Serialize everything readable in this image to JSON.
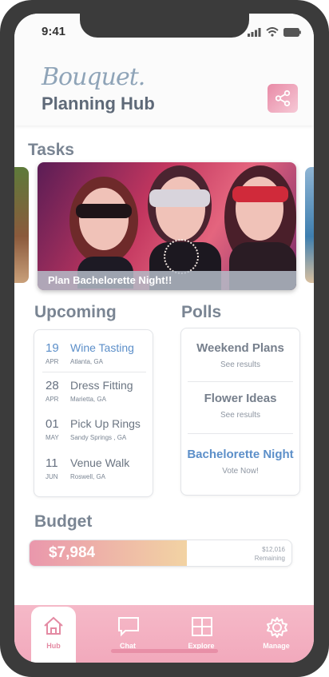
{
  "status": {
    "time": "9:41"
  },
  "header": {
    "logo": "Bouquet.",
    "title": "Planning Hub",
    "share_icon": "share-icon"
  },
  "tasks": {
    "heading": "Tasks",
    "card_label": "Plan Bachelorette Night!!"
  },
  "upcoming": {
    "heading": "Upcoming",
    "items": [
      {
        "day": "19",
        "month": "APR",
        "title": "Wine Tasting",
        "location": "Atlanta, GA",
        "highlight": true
      },
      {
        "day": "28",
        "month": "APR",
        "title": "Dress Fitting",
        "location": "Marietta, GA",
        "highlight": false
      },
      {
        "day": "01",
        "month": "MAY",
        "title": "Pick Up Rings",
        "location": "Sandy Springs , GA",
        "highlight": false
      },
      {
        "day": "11",
        "month": "JUN",
        "title": "Venue Walk",
        "location": "Roswell, GA",
        "highlight": false
      }
    ]
  },
  "polls": {
    "heading": "Polls",
    "items": [
      {
        "title": "Weekend Plans",
        "sub": "See results"
      },
      {
        "title": "Flower Ideas",
        "sub": "See results"
      },
      {
        "title": "Bachelorette Night",
        "sub": "Vote Now!"
      }
    ]
  },
  "budget": {
    "heading": "Budget",
    "spent": "$7,984",
    "remaining_amount": "$12,016",
    "remaining_label": "Remaining",
    "spent_fraction": 0.6
  },
  "tabs": [
    {
      "label": "Hub",
      "icon": "home-icon",
      "active": true
    },
    {
      "label": "Chat",
      "icon": "chat-icon",
      "active": false
    },
    {
      "label": "Explore",
      "icon": "grid-icon",
      "active": false
    },
    {
      "label": "Manage",
      "icon": "gear-icon",
      "active": false
    }
  ],
  "colors": {
    "accent_pink": "#e88aa6",
    "highlight_blue": "#5c8fc9",
    "text_gray": "#7a8593"
  }
}
